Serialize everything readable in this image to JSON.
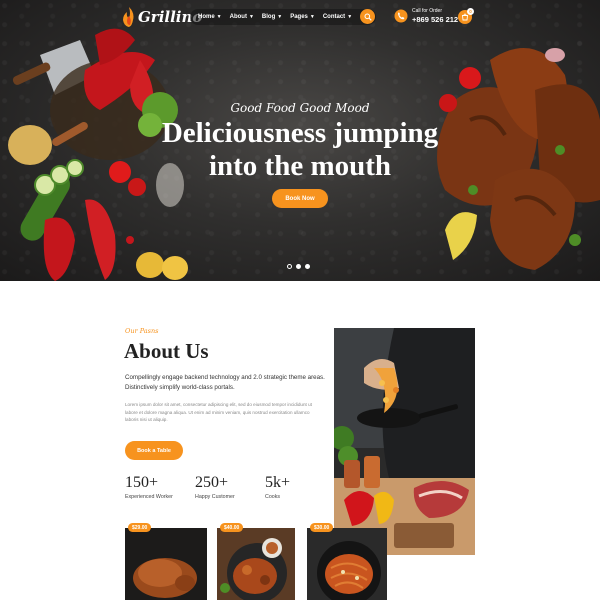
{
  "brand": {
    "name": "Grillino",
    "accent": "#f7931e"
  },
  "nav": {
    "items": [
      {
        "label": "Home"
      },
      {
        "label": "About"
      },
      {
        "label": "Blog"
      },
      {
        "label": "Pages"
      },
      {
        "label": "Contact"
      }
    ],
    "search_icon": "search-icon"
  },
  "call": {
    "label": "Call for Order",
    "number": "+869 526 212",
    "icon": "phone-icon"
  },
  "cart": {
    "count": "0",
    "icon": "cart-icon"
  },
  "hero": {
    "tagline": "Good Food Good Mood",
    "title": "Deliciousness jumping into the mouth",
    "button": "Book Now",
    "slides": 3,
    "active_slide": 1
  },
  "about": {
    "subtitle": "Our Pasns",
    "title": "About Us",
    "lead": "Compellingly engage backend technology and 2.0 strategic theme areas. Distinctively simplify world-class portals.",
    "body": "Lorem ipsum dolor sit amet, consectetur adipiscing elit, sed do eiusmod tempor incididunt ut labore et dolore magna aliqua. Ut enim ad minim veniam, quis nostrud exercitation ullamco laboris nisi ut aliquip.",
    "button": "Book a Table",
    "stats": [
      {
        "value": "150+",
        "label": "Experienced Worker"
      },
      {
        "value": "250+",
        "label": "Happy Customer"
      },
      {
        "value": "5k+",
        "label": "Cooks"
      }
    ]
  },
  "dishes": [
    {
      "price": "$29.00"
    },
    {
      "price": "$40.00"
    },
    {
      "price": "$30.00"
    }
  ]
}
